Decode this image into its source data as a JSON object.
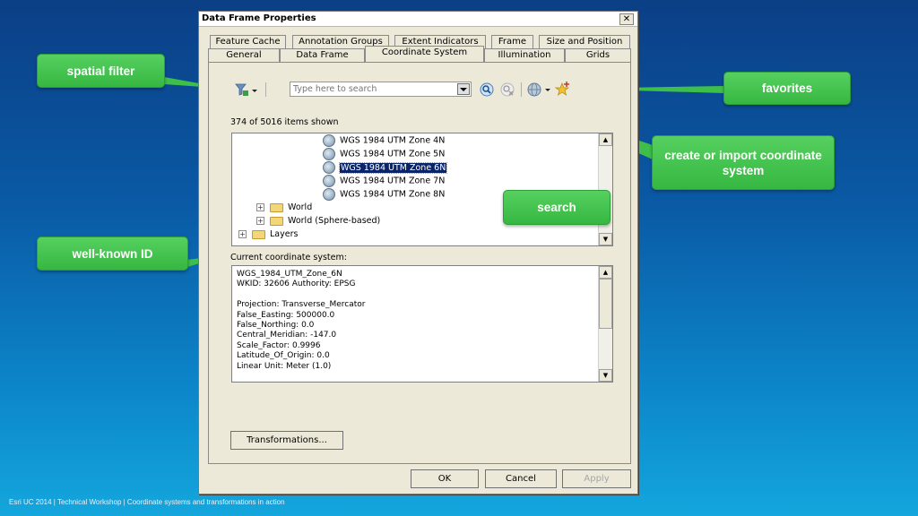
{
  "dialog": {
    "title": "Data Frame Properties",
    "close_label": "✕",
    "tabs_row1": [
      "Feature Cache",
      "Annotation Groups",
      "Extent Indicators",
      "Frame",
      "Size and Position"
    ],
    "tabs_row2": [
      "General",
      "Data Frame",
      "Coordinate System",
      "Illumination",
      "Grids"
    ],
    "active_tab": "Coordinate System"
  },
  "toolbar": {
    "search_placeholder": "Type here to search",
    "icons": [
      "spatial-filter-icon",
      "search-icon",
      "clear-search-icon",
      "add-coordinate-system-icon",
      "add-to-favorites-icon"
    ]
  },
  "items_shown": "374 of 5016 items shown",
  "tree": {
    "items": [
      {
        "label": "WGS 1984 UTM Zone 4N",
        "type": "globe",
        "selected": false
      },
      {
        "label": "WGS 1984 UTM Zone 5N",
        "type": "globe",
        "selected": false
      },
      {
        "label": "WGS 1984 UTM Zone 6N",
        "type": "globe",
        "selected": true
      },
      {
        "label": "WGS 1984 UTM Zone 7N",
        "type": "globe",
        "selected": false
      },
      {
        "label": "WGS 1984 UTM Zone 8N",
        "type": "globe",
        "selected": false
      },
      {
        "label": "World",
        "type": "folder",
        "selected": false
      },
      {
        "label": "World (Sphere-based)",
        "type": "folder",
        "selected": false
      },
      {
        "label": "Layers",
        "type": "folder",
        "selected": false
      }
    ]
  },
  "current": {
    "label": "Current coordinate system:",
    "text": "WGS_1984_UTM_Zone_6N\nWKID: 32606 Authority: EPSG\n\nProjection: Transverse_Mercator\nFalse_Easting: 500000.0\nFalse_Northing: 0.0\nCentral_Meridian: -147.0\nScale_Factor: 0.9996\nLatitude_Of_Origin: 0.0\nLinear Unit: Meter (1.0)"
  },
  "buttons": {
    "transformations": "Transformations...",
    "ok": "OK",
    "cancel": "Cancel",
    "apply": "Apply"
  },
  "callouts": {
    "spatial_filter": "spatial filter",
    "favorites": "favorites",
    "create_import": "create or import coordinate system",
    "search": "search",
    "well_known_id": "well-known ID"
  },
  "footer": "Esri UC 2014 | Technical Workshop |  Coordinate systems and transformations in action",
  "colors": {
    "callout_green": "#3ebf4a",
    "selection_blue": "#0a246a",
    "background_top": "#0b3f86",
    "background_bottom": "#14a6dd"
  }
}
